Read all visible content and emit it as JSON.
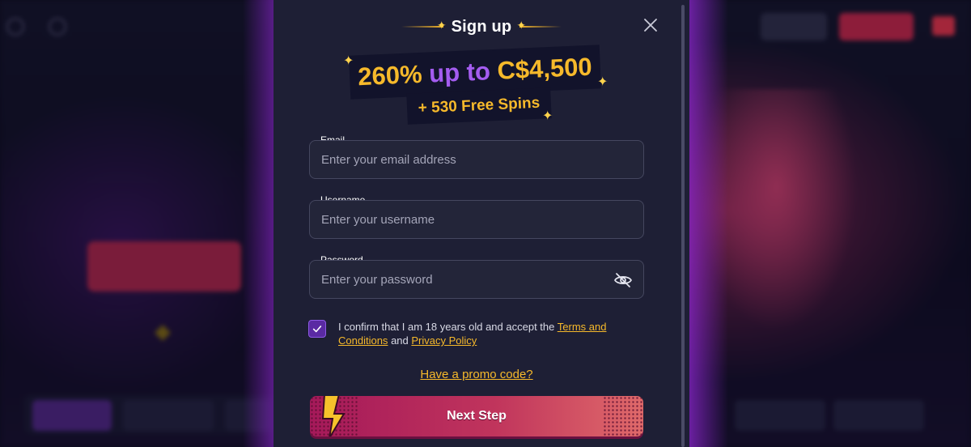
{
  "modal": {
    "title": "Sign up",
    "promo": {
      "line1_amount": "260%",
      "line1_up_to": "up to",
      "line1_cash": "C$4,500",
      "line2": "+ 530 Free Spins"
    },
    "fields": {
      "email": {
        "label": "Email",
        "placeholder": "Enter your email address"
      },
      "username": {
        "label": "Username",
        "placeholder": "Enter your username"
      },
      "password": {
        "label": "Password",
        "placeholder": "Enter your password"
      }
    },
    "consent": {
      "checked": true,
      "prefix": "I confirm that I am 18 years old and accept the",
      "terms_link": "Terms and Conditions",
      "and": "and",
      "privacy_link": "Privacy Policy"
    },
    "promo_code_link": "Have a promo code?",
    "next_button": "Next Step"
  },
  "colors": {
    "modal_bg": "#1e1f35",
    "accent_gold": "#f6b92b",
    "accent_purple": "#a45cf0",
    "button_gradient_start": "#a5195a",
    "button_gradient_end": "#e06a6a"
  }
}
